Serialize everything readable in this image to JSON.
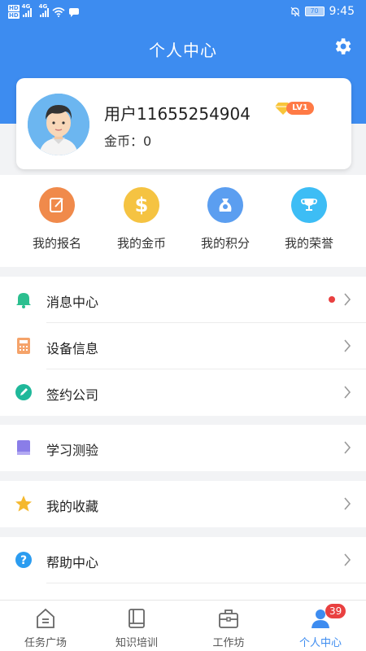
{
  "status_bar": {
    "network_top": "HD",
    "network_bottom": "HD",
    "sig1_label": "4G",
    "sig2_label": "4G",
    "battery": "70",
    "time": "9:45"
  },
  "header": {
    "title": "个人中心",
    "settings_icon": "gear-icon"
  },
  "profile": {
    "username": "用户11655254904",
    "level_badge": "LV1",
    "coins_label": "金币：",
    "coins_value": "0"
  },
  "quick_actions": [
    {
      "label": "我的报名",
      "icon": "edit-note-icon",
      "color": "#f08a4b"
    },
    {
      "label": "我的金币",
      "icon": "dollar-icon",
      "color": "#f5c342"
    },
    {
      "label": "我的积分",
      "icon": "points-bag-icon",
      "color": "#5b9ef0"
    },
    {
      "label": "我的荣誉",
      "icon": "trophy-icon",
      "color": "#3dbdf5"
    }
  ],
  "menu": [
    {
      "label": "消息中心",
      "icon": "bell-icon",
      "has_dot": true
    },
    {
      "label": "设备信息",
      "icon": "calculator-icon"
    },
    {
      "label": "签约公司",
      "icon": "pen-icon"
    },
    {
      "label": "学习测验",
      "icon": "book-icon"
    },
    {
      "label": "我的收藏",
      "icon": "star-icon"
    },
    {
      "label": "帮助中心",
      "icon": "help-icon"
    }
  ],
  "bottom_nav": [
    {
      "label": "任务广场",
      "icon": "home-icon"
    },
    {
      "label": "知识培训",
      "icon": "notebook-icon"
    },
    {
      "label": "工作坊",
      "icon": "briefcase-icon"
    },
    {
      "label": "个人中心",
      "icon": "user-icon",
      "active": true,
      "badge": "39"
    }
  ],
  "colors": {
    "primary": "#3d8cf0",
    "badge_red": "#e94040",
    "level_orange": "#ff7a45"
  }
}
